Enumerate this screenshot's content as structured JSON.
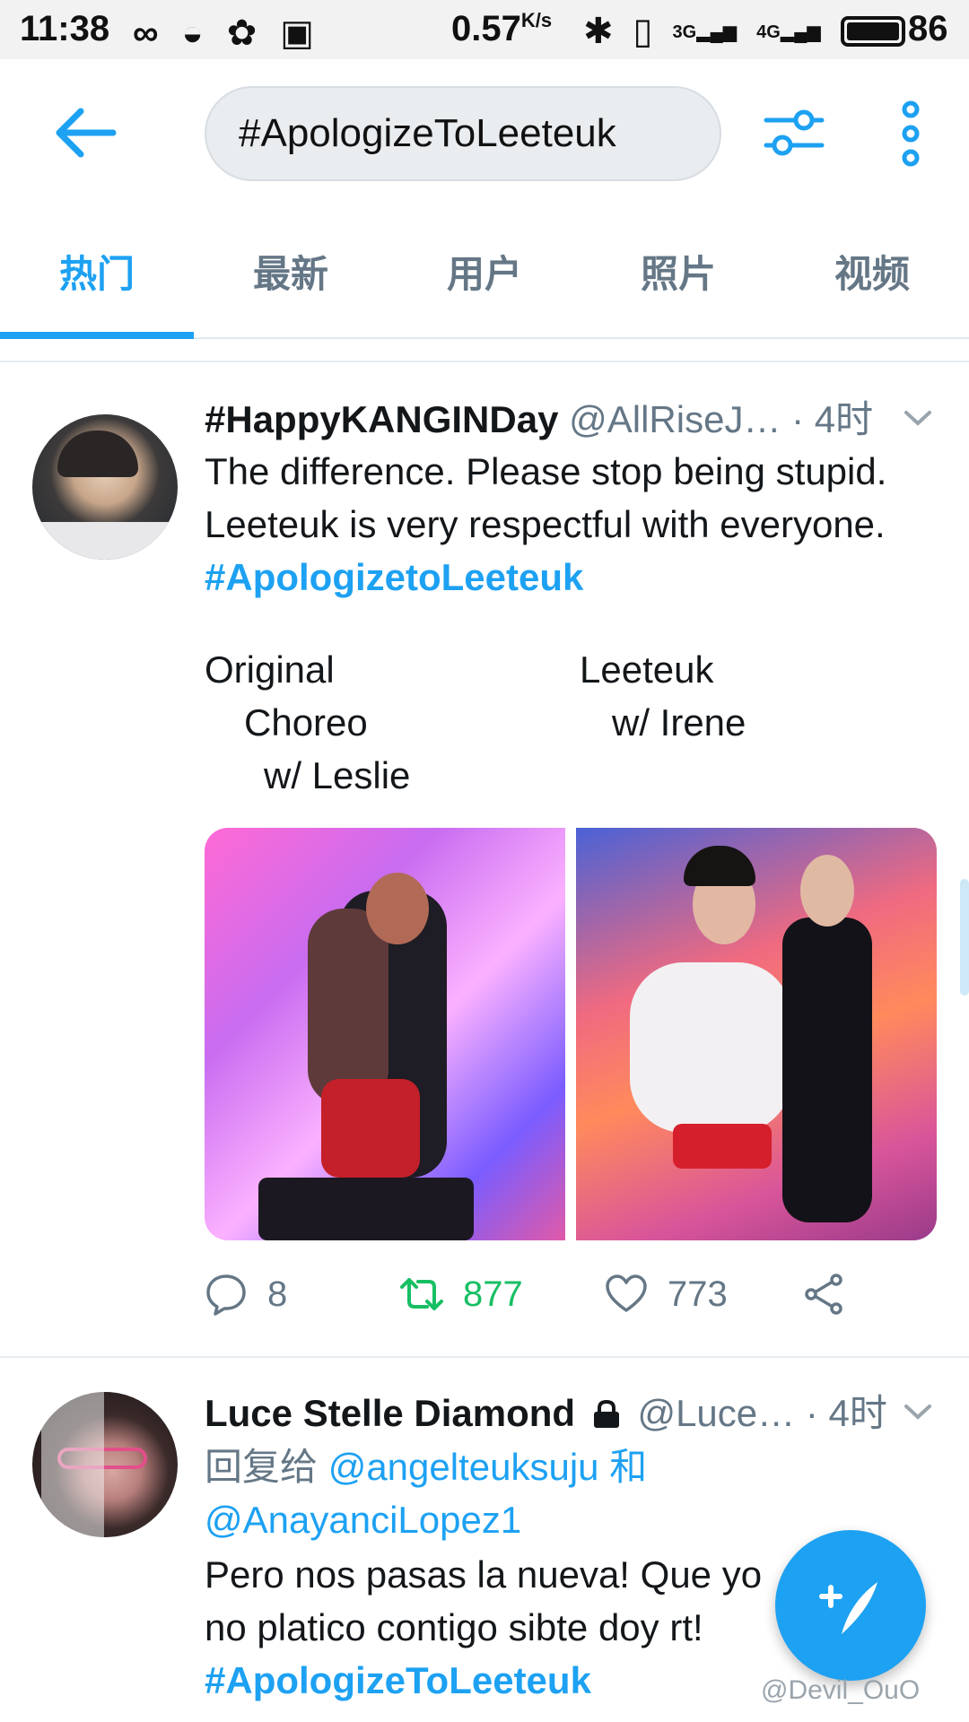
{
  "status_bar": {
    "time": "11:38",
    "speed": "0.57",
    "speed_unit": "K/s",
    "signal_1": "3G",
    "signal_2": "4G",
    "battery": "86"
  },
  "header": {
    "search_query": "#ApologizeToLeeteuk"
  },
  "tabs": [
    {
      "label": "热门",
      "active": true
    },
    {
      "label": "最新",
      "active": false
    },
    {
      "label": "用户",
      "active": false
    },
    {
      "label": "照片",
      "active": false
    },
    {
      "label": "视频",
      "active": false
    }
  ],
  "tweets": [
    {
      "name": "#HappyKANGINDay",
      "handle": "@AllRiseJ…",
      "time": "· 4时",
      "line1": "The difference. Please stop being stupid.",
      "line2": "Leeteuk is very respectful with everyone.",
      "hashtag": "#ApologizetoLeeteuk",
      "caption_left_1": "Original",
      "caption_left_2": "Choreo",
      "caption_left_3": "w/ Leslie",
      "caption_right_1": "Leeteuk",
      "caption_right_2": "w/ Irene",
      "replies": "8",
      "retweets": "877",
      "likes": "773"
    },
    {
      "name": "Luce Stelle Diamond",
      "handle": "@Luce…",
      "time": "· 4时",
      "reply_prefix": "回复给",
      "mention_1": "@angelteuksuju",
      "reply_and": "和",
      "mention_2": "@AnayanciLopez1",
      "line1": "Pero nos pasas la nueva! Que yo",
      "line2": "no platico contigo sibte doy rt!",
      "hashtag": "#ApologizeToLeeteuk"
    }
  ],
  "watermark": "@Devil_OuO",
  "colors": {
    "accent": "#1da1f2",
    "retweet": "#17bf63",
    "secondary_text": "#657786"
  }
}
